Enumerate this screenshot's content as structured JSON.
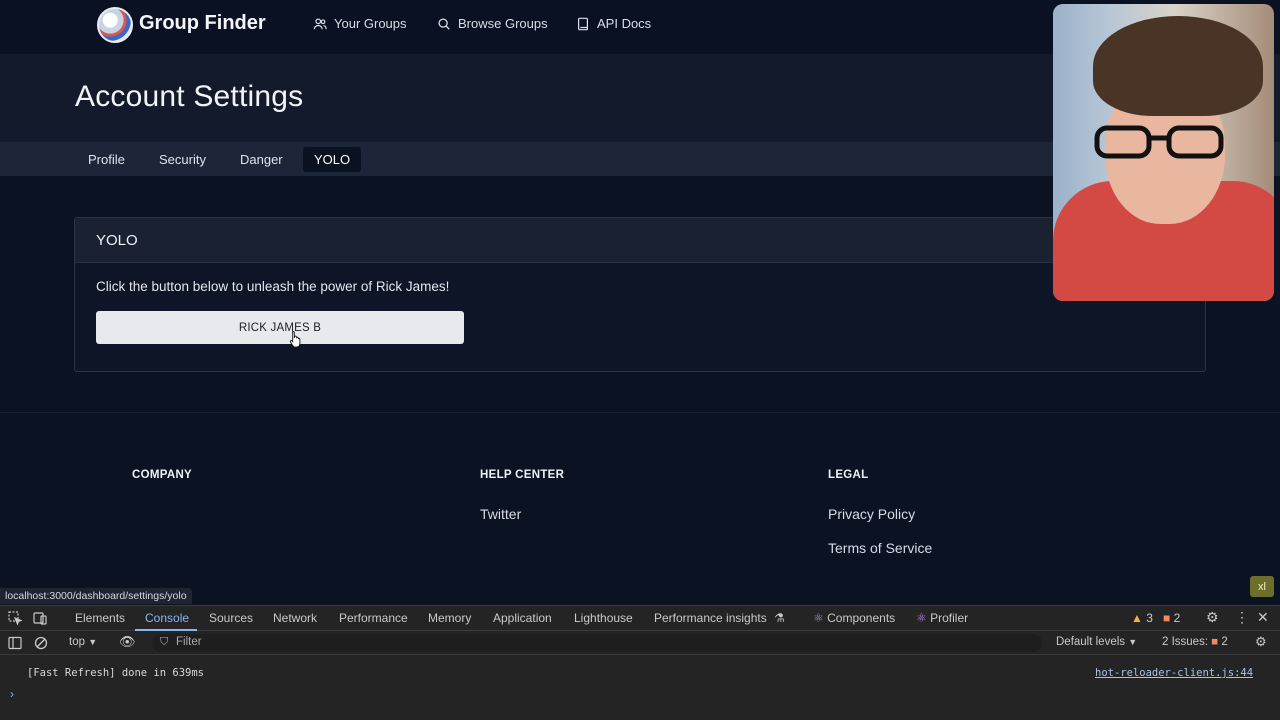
{
  "nav": {
    "brand": "Group Finder",
    "links": [
      {
        "label": "Your Groups",
        "icon": "users-icon"
      },
      {
        "label": "Browse Groups",
        "icon": "search-icon"
      },
      {
        "label": "API Docs",
        "icon": "book-icon"
      }
    ]
  },
  "page": {
    "title": "Account Settings",
    "tabs": [
      {
        "label": "Profile",
        "active": false
      },
      {
        "label": "Security",
        "active": false
      },
      {
        "label": "Danger",
        "active": false
      },
      {
        "label": "YOLO",
        "active": true
      }
    ]
  },
  "card": {
    "title": "YOLO",
    "text": "Click the button below to unleash the power of Rick James!",
    "button_label": "RICK JAMES B"
  },
  "footer": {
    "columns": [
      {
        "heading": "COMPANY",
        "links": []
      },
      {
        "heading": "HELP CENTER",
        "links": [
          "Twitter"
        ]
      },
      {
        "heading": "LEGAL",
        "links": [
          "Privacy Policy",
          "Terms of Service"
        ]
      }
    ]
  },
  "status_url": "localhost:3000/dashboard/settings/yolo",
  "xl_badge": "xl",
  "devtools": {
    "tabs": [
      "Elements",
      "Console",
      "Sources",
      "Network",
      "Performance",
      "Memory",
      "Application",
      "Lighthouse",
      "Performance insights",
      "Components",
      "Profiler"
    ],
    "active_tab": "Console",
    "warnings": "3",
    "errors": "2",
    "context": "top",
    "filter_placeholder": "Filter",
    "levels": "Default levels",
    "issues_label": "2 Issues:",
    "issues_count": "2",
    "console": [
      {
        "text": "[Fast Refresh] done in 639ms",
        "source": "hot-reloader-client.js:44"
      }
    ]
  },
  "colors": {
    "background": "#0b1222",
    "tabs_bar": "#1c2638",
    "button": "#e7e9ed",
    "devtools_accent": "#8ab4f8"
  }
}
